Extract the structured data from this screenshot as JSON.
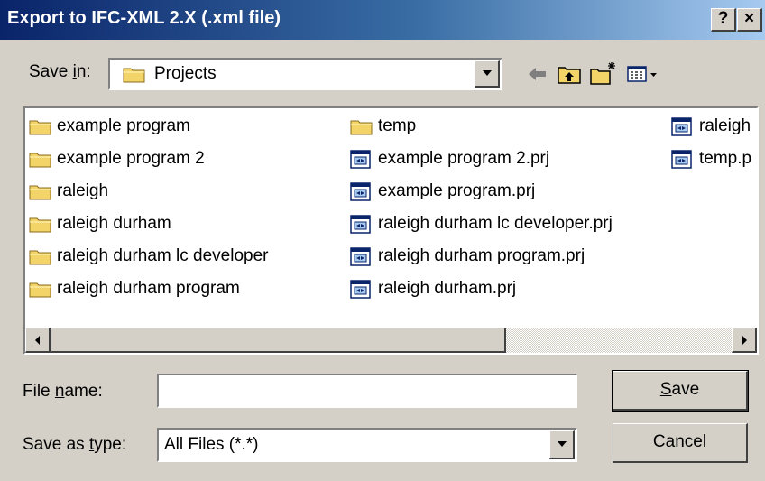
{
  "window": {
    "title": "Export to IFC-XML 2.X (.xml file)",
    "help_label": "?",
    "close_label": "×"
  },
  "toolbar": {
    "save_in_label_pre": "Save ",
    "save_in_label_key": "i",
    "save_in_label_post": "n:",
    "location": "Projects",
    "icons": [
      "back-arrow-icon",
      "up-one-level-icon",
      "new-folder-icon",
      "view-menu-icon"
    ]
  },
  "files": {
    "columns": [
      [
        {
          "name": "example program",
          "type": "folder"
        },
        {
          "name": "example program 2",
          "type": "folder"
        },
        {
          "name": "raleigh",
          "type": "folder"
        },
        {
          "name": "raleigh durham",
          "type": "folder"
        },
        {
          "name": "raleigh durham lc developer",
          "type": "folder"
        },
        {
          "name": "raleigh durham program",
          "type": "folder"
        }
      ],
      [
        {
          "name": "temp",
          "type": "folder"
        },
        {
          "name": "example program 2.prj",
          "type": "file"
        },
        {
          "name": "example program.prj",
          "type": "file"
        },
        {
          "name": "raleigh durham lc developer.prj",
          "type": "file"
        },
        {
          "name": "raleigh durham program.prj",
          "type": "file"
        },
        {
          "name": "raleigh durham.prj",
          "type": "file"
        }
      ],
      [
        {
          "name": "raleigh",
          "type": "file"
        },
        {
          "name": "temp.p",
          "type": "file"
        }
      ]
    ]
  },
  "form": {
    "file_name_label_pre": "File ",
    "file_name_label_key": "n",
    "file_name_label_post": "ame:",
    "file_name_value": "",
    "save_type_label_pre": "Save as ",
    "save_type_label_key": "t",
    "save_type_label_post": "ype:",
    "save_type_value": "All Files (*.*)"
  },
  "buttons": {
    "save_key": "S",
    "save_rest": "ave",
    "cancel": "Cancel"
  },
  "colors": {
    "title_start": "#0a246a",
    "title_end": "#a6caf0",
    "face": "#d4d0c8",
    "folder": "#f3d469"
  }
}
